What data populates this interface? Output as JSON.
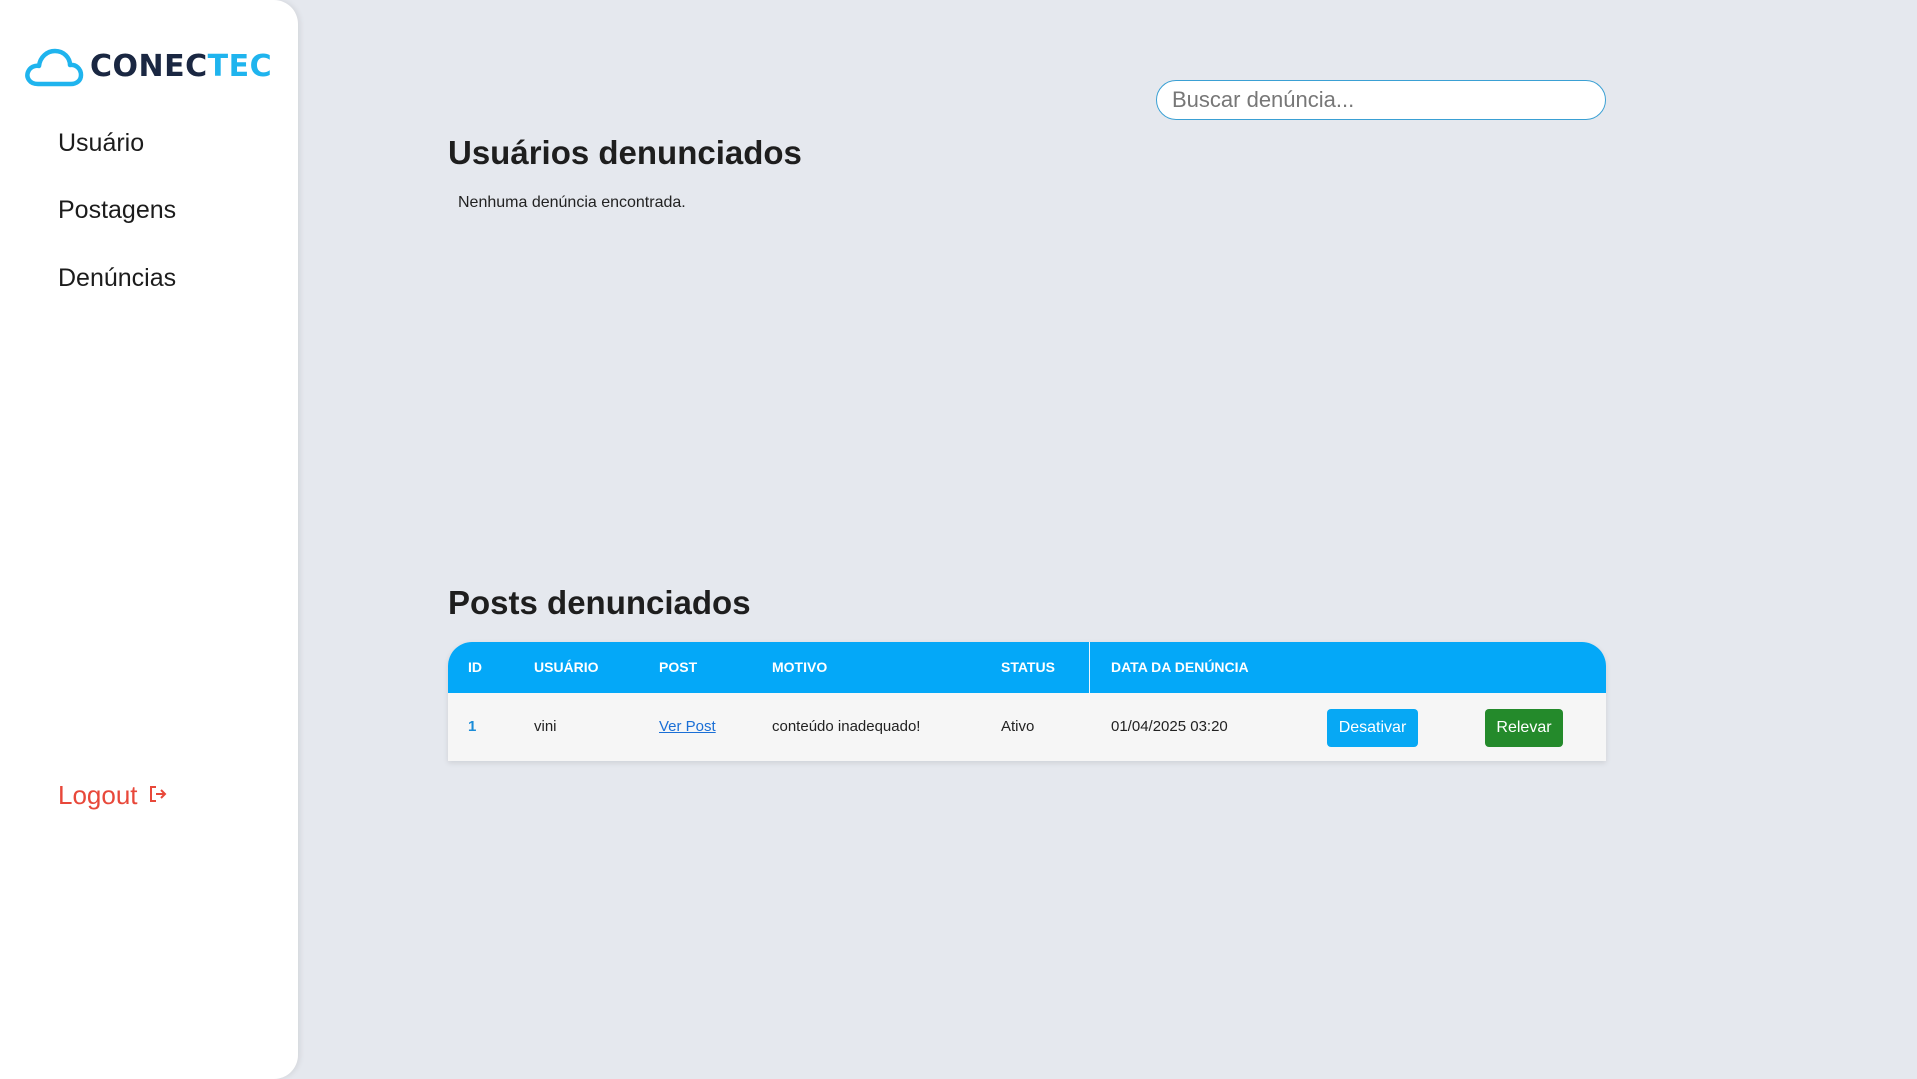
{
  "brand": {
    "name_part1": "CONEC",
    "name_part2": "TEC",
    "colors": {
      "dark": "#1a2742",
      "accent": "#1fb4ee"
    }
  },
  "sidebar": {
    "items": [
      {
        "label": "Usuário"
      },
      {
        "label": "Postagens"
      },
      {
        "label": "Denúncias"
      }
    ],
    "logout_label": "Logout"
  },
  "search": {
    "placeholder": "Buscar denúncia..."
  },
  "reported_users": {
    "title": "Usuários denunciados",
    "empty_message": "Nenhuma denúncia encontrada."
  },
  "reported_posts": {
    "title": "Posts denunciados",
    "columns": [
      "ID",
      "USUÁRIO",
      "POST",
      "MOTIVO",
      "STATUS",
      "DATA DA DENÚNCIA"
    ],
    "rows": [
      {
        "id": "1",
        "user": "vini",
        "post_link": "Ver Post",
        "reason": "conteúdo inadequado!",
        "status": "Ativo",
        "date": "01/04/2025 03:20",
        "action_primary": "Desativar",
        "action_secondary": "Relevar"
      }
    ],
    "colors": {
      "header": "#04a8f8",
      "desativar": "#07a8f4",
      "relevar": "#248a2b"
    }
  },
  "icons": {
    "logo": "cloud-icon",
    "logout": "logout-icon"
  }
}
